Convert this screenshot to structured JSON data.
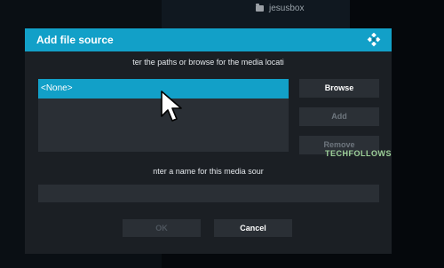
{
  "background": {
    "top_item_label": "jesusbox",
    "top_item_icon": "folder-icon"
  },
  "dialog": {
    "title": "Add file source",
    "logo_icon": "kodi-logo-icon",
    "paths_instruction": "ter the paths or browse for the media locati",
    "paths": [
      "<None>"
    ],
    "buttons": {
      "browse": "Browse",
      "add": "Add",
      "remove": "Remove"
    },
    "name_instruction": "nter a name for this media sour",
    "name_value": "",
    "ok": "OK",
    "cancel": "Cancel"
  },
  "watermark": "TECHFOLLOWS",
  "colors": {
    "accent": "#12a0c8",
    "dialog_bg": "#1b1f24",
    "field_bg": "#2a2f35"
  }
}
